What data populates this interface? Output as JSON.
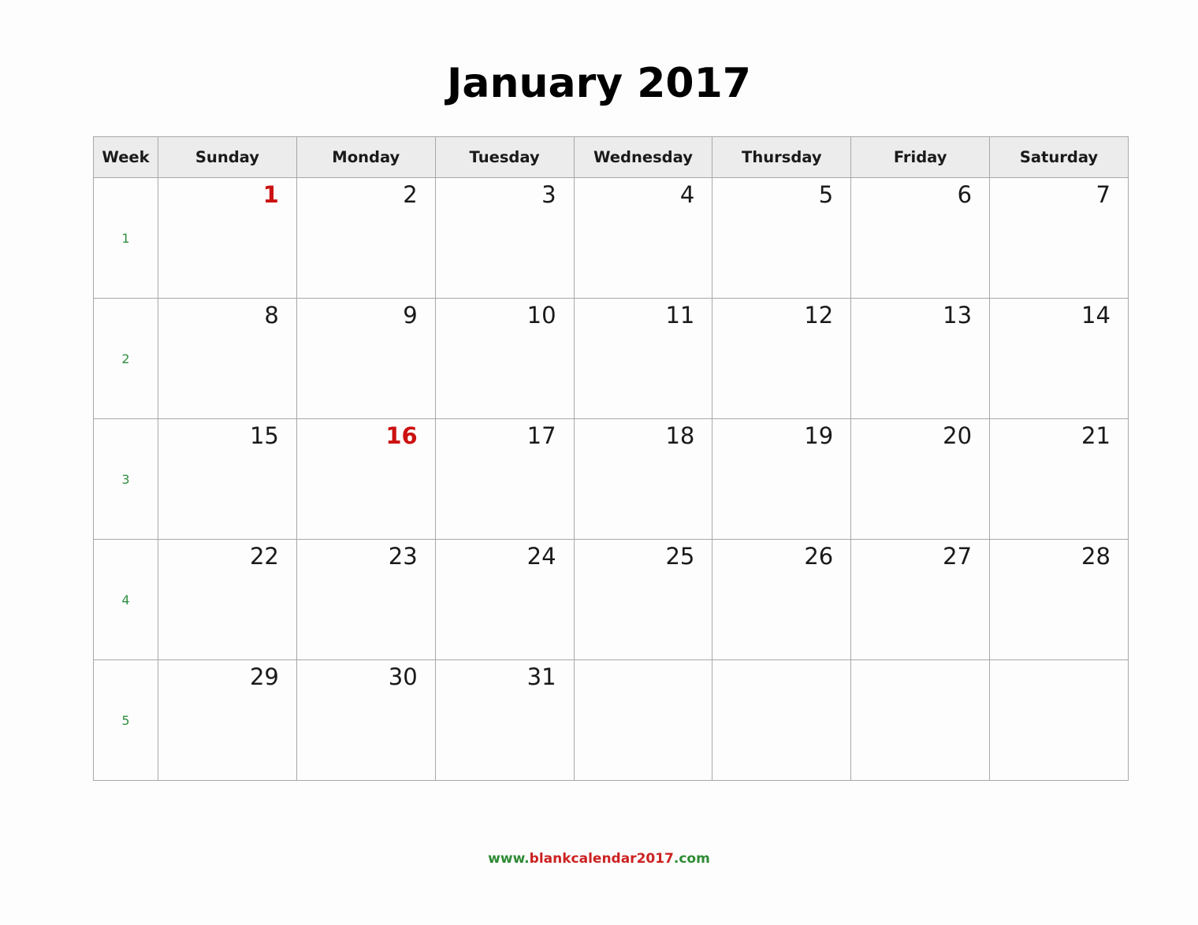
{
  "title": "January 2017",
  "colors": {
    "holiday": "#cc1111",
    "week_number": "#2f8f3f",
    "header_bg": "#ececec",
    "grid_line": "#a8a8a8",
    "text": "#1a1a1a",
    "footer_green": "#2e8b34",
    "footer_red": "#cc2222"
  },
  "headers": {
    "week": "Week",
    "days": [
      "Sunday",
      "Monday",
      "Tuesday",
      "Wednesday",
      "Thursday",
      "Friday",
      "Saturday"
    ]
  },
  "weeks": [
    {
      "week_number": "1",
      "days": [
        {
          "label": "1",
          "holiday": true,
          "empty": false
        },
        {
          "label": "2",
          "holiday": false,
          "empty": false
        },
        {
          "label": "3",
          "holiday": false,
          "empty": false
        },
        {
          "label": "4",
          "holiday": false,
          "empty": false
        },
        {
          "label": "5",
          "holiday": false,
          "empty": false
        },
        {
          "label": "6",
          "holiday": false,
          "empty": false
        },
        {
          "label": "7",
          "holiday": false,
          "empty": false
        }
      ]
    },
    {
      "week_number": "2",
      "days": [
        {
          "label": "8",
          "holiday": false,
          "empty": false
        },
        {
          "label": "9",
          "holiday": false,
          "empty": false
        },
        {
          "label": "10",
          "holiday": false,
          "empty": false
        },
        {
          "label": "11",
          "holiday": false,
          "empty": false
        },
        {
          "label": "12",
          "holiday": false,
          "empty": false
        },
        {
          "label": "13",
          "holiday": false,
          "empty": false
        },
        {
          "label": "14",
          "holiday": false,
          "empty": false
        }
      ]
    },
    {
      "week_number": "3",
      "days": [
        {
          "label": "15",
          "holiday": false,
          "empty": false
        },
        {
          "label": "16",
          "holiday": true,
          "empty": false
        },
        {
          "label": "17",
          "holiday": false,
          "empty": false
        },
        {
          "label": "18",
          "holiday": false,
          "empty": false
        },
        {
          "label": "19",
          "holiday": false,
          "empty": false
        },
        {
          "label": "20",
          "holiday": false,
          "empty": false
        },
        {
          "label": "21",
          "holiday": false,
          "empty": false
        }
      ]
    },
    {
      "week_number": "4",
      "days": [
        {
          "label": "22",
          "holiday": false,
          "empty": false
        },
        {
          "label": "23",
          "holiday": false,
          "empty": false
        },
        {
          "label": "24",
          "holiday": false,
          "empty": false
        },
        {
          "label": "25",
          "holiday": false,
          "empty": false
        },
        {
          "label": "26",
          "holiday": false,
          "empty": false
        },
        {
          "label": "27",
          "holiday": false,
          "empty": false
        },
        {
          "label": "28",
          "holiday": false,
          "empty": false
        }
      ]
    },
    {
      "week_number": "5",
      "days": [
        {
          "label": "29",
          "holiday": false,
          "empty": false
        },
        {
          "label": "30",
          "holiday": false,
          "empty": false
        },
        {
          "label": "31",
          "holiday": false,
          "empty": false
        },
        {
          "label": "",
          "holiday": false,
          "empty": true
        },
        {
          "label": "",
          "holiday": false,
          "empty": true
        },
        {
          "label": "",
          "holiday": false,
          "empty": true
        },
        {
          "label": "",
          "holiday": false,
          "empty": true
        }
      ]
    }
  ],
  "footer": {
    "prefix": "www.",
    "name": "blankcalendar2017",
    "suffix": ".com",
    "full": "www.blankcalendar2017.com"
  }
}
